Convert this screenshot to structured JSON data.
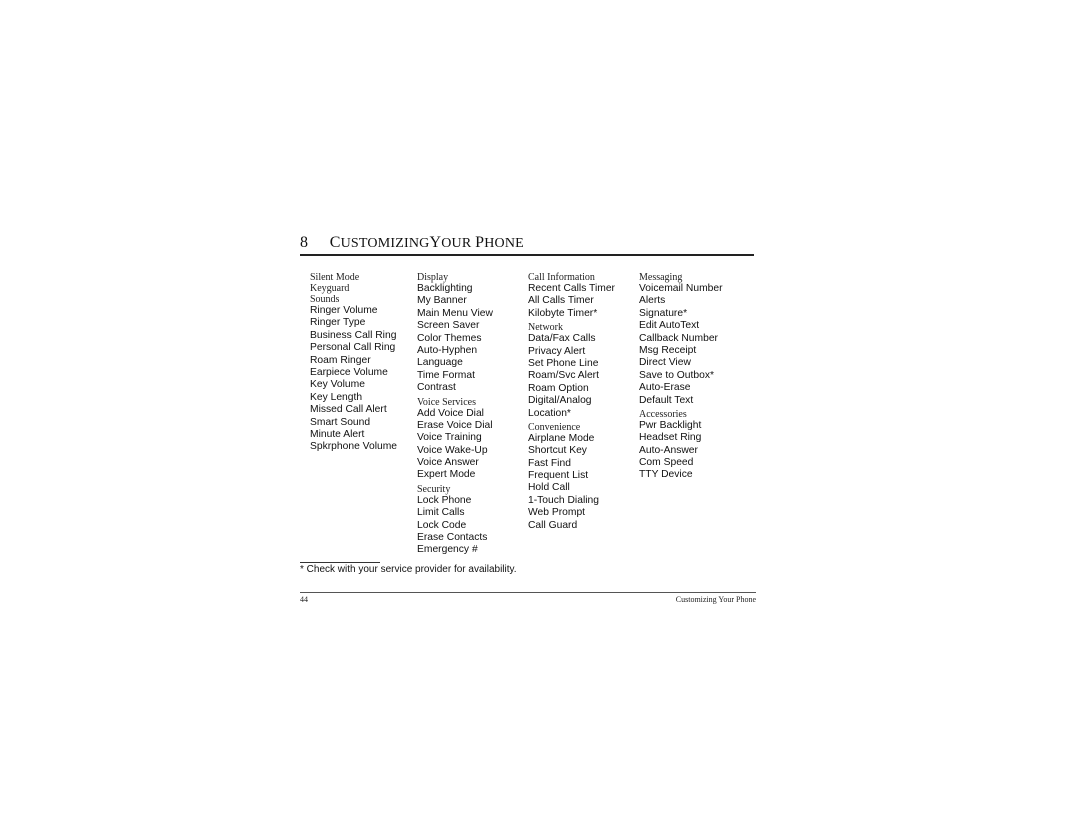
{
  "heading": {
    "chapter_number": "8",
    "title_parts": [
      "C",
      "USTOMIZING",
      "Y",
      "OUR",
      "P",
      "HONE"
    ],
    "title": "Customizing Your Phone"
  },
  "columns": [
    {
      "groups": [
        {
          "section": "Silent Mode",
          "items": []
        },
        {
          "section": "Keyguard",
          "items": []
        },
        {
          "section": "Sounds",
          "items": [
            "Ringer Volume",
            "Ringer Type",
            "Business Call Ring",
            "Personal Call Ring",
            "Roam Ringer",
            "Earpiece Volume",
            "Key Volume",
            "Key Length",
            "Missed Call Alert",
            "Smart Sound",
            "Minute Alert",
            "Spkrphone Volume"
          ]
        }
      ]
    },
    {
      "groups": [
        {
          "section": "Display",
          "items": [
            "Backlighting",
            "My Banner",
            "Main Menu View",
            "Screen Saver",
            "Color Themes",
            "Auto-Hyphen",
            "Language",
            "Time Format",
            "Contrast"
          ]
        },
        {
          "section": "Voice Services",
          "items": [
            "Add Voice Dial",
            "Erase Voice Dial",
            "Voice Training",
            "Voice Wake-Up",
            "Voice Answer",
            "Expert Mode"
          ]
        },
        {
          "section": "Security",
          "items": [
            "Lock Phone",
            "Limit Calls",
            "Lock Code",
            "Erase Contacts",
            "Emergency #"
          ]
        }
      ]
    },
    {
      "groups": [
        {
          "section": "Call Information",
          "items": [
            "Recent Calls Timer",
            "All Calls Timer",
            "Kilobyte Timer*"
          ]
        },
        {
          "section": "Network",
          "items": [
            "Data/Fax Calls",
            "Privacy Alert",
            "Set Phone Line",
            "Roam/Svc Alert",
            "Roam Option",
            "Digital/Analog",
            "Location*"
          ]
        },
        {
          "section": "Convenience",
          "items": [
            "Airplane Mode",
            "Shortcut Key",
            "Fast Find",
            "Frequent List",
            "Hold Call",
            "1-Touch Dialing",
            "Web Prompt",
            "Call Guard"
          ]
        }
      ]
    },
    {
      "groups": [
        {
          "section": "Messaging",
          "items": [
            "Voicemail Number",
            "Alerts",
            "Signature*",
            "Edit AutoText",
            "Callback Number",
            "Msg Receipt",
            "Direct View",
            "Save to Outbox*",
            "Auto-Erase",
            "Default Text"
          ]
        },
        {
          "section": "Accessories",
          "items": [
            "Pwr Backlight",
            "Headset Ring",
            "Auto-Answer",
            "Com Speed",
            "TTY Device"
          ]
        }
      ]
    }
  ],
  "footnote": "* Check with your service provider for availability.",
  "footer": {
    "page_number": "44",
    "running_title": "Customizing Your Phone"
  }
}
